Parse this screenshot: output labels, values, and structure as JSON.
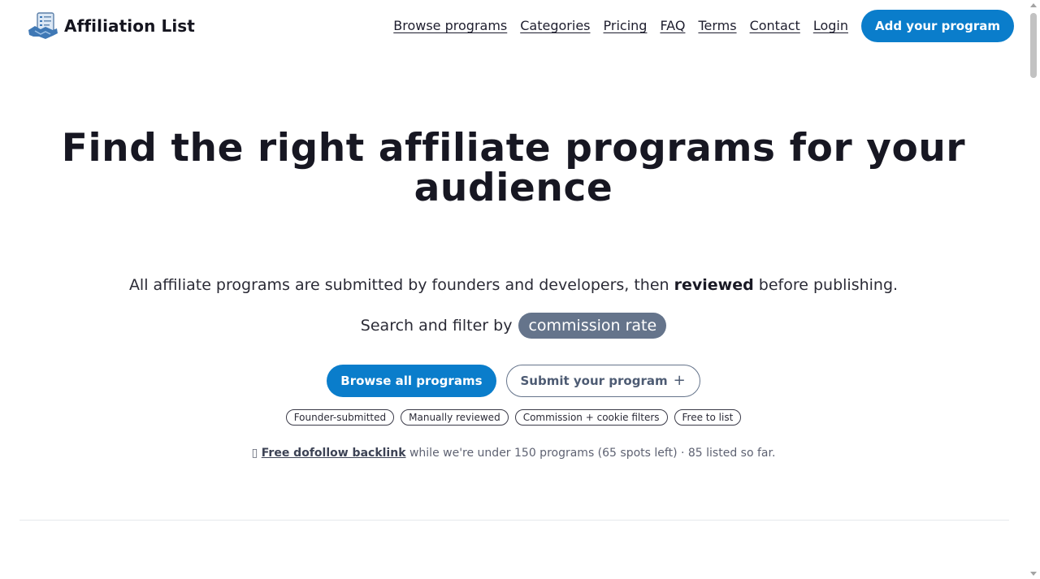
{
  "brand": {
    "name": "Affiliation List",
    "logo_icon": "handshake-checklist-icon"
  },
  "nav": {
    "links": [
      "Browse programs",
      "Categories",
      "Pricing",
      "FAQ",
      "Terms",
      "Contact",
      "Login"
    ],
    "cta_label": "Add your program"
  },
  "hero": {
    "title": "Find the right affiliate programs for your audience",
    "subtitle_pre": "All affiliate programs are submitted by founders and developers, then",
    "subtitle_bold": "reviewed",
    "subtitle_post": "before publishing.",
    "search_prefix": "Search and filter by",
    "search_pill": "commission rate"
  },
  "buttons": {
    "browse_label": "Browse all programs",
    "submit_label": "Submit your program",
    "submit_icon": "plus-icon"
  },
  "tags": [
    "Founder-submitted",
    "Manually reviewed",
    "Commission + cookie filters",
    "Free to list"
  ],
  "backlink": {
    "glyph": "▯",
    "link_text": "Free dofollow backlink",
    "text": "while we're under 150 programs (65 spots left) · 85 listed so far."
  },
  "colors": {
    "accent": "#0a7dcb",
    "pill": "#65748b",
    "text": "#1e1e2e"
  }
}
